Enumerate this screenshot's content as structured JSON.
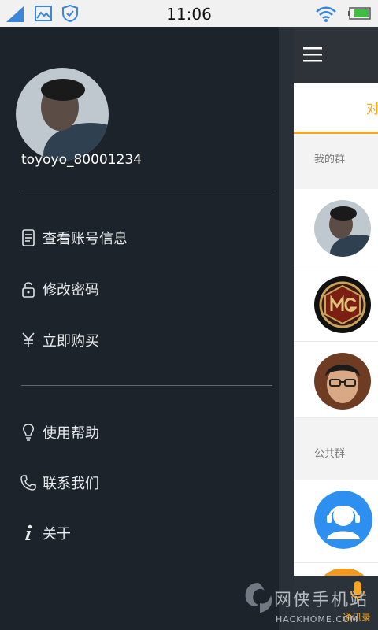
{
  "status_bar": {
    "time": "11:06"
  },
  "drawer": {
    "username": "toyoyo_80001234",
    "menu_group_1": [
      {
        "label": "查看账号信息",
        "icon": "id-card-icon"
      },
      {
        "label": "修改密码",
        "icon": "unlock-icon"
      },
      {
        "label": "立即购买",
        "icon": "yen-icon"
      }
    ],
    "menu_group_2": [
      {
        "label": "使用帮助",
        "icon": "lightbulb-icon"
      },
      {
        "label": "联系我们",
        "icon": "phone-icon"
      },
      {
        "label": "关于",
        "icon": "info-icon"
      }
    ]
  },
  "main": {
    "tab_label": "对",
    "section_my_groups": "我的群",
    "section_public_groups": "公共群",
    "bottom_tab_label": "通讯录"
  },
  "watermark": {
    "text": "网侠手机站",
    "sub": "HACKHOME.COM"
  },
  "colors": {
    "accent": "#f6a623",
    "drawer_bg": "#1d232a",
    "topbar": "#2e333a"
  }
}
